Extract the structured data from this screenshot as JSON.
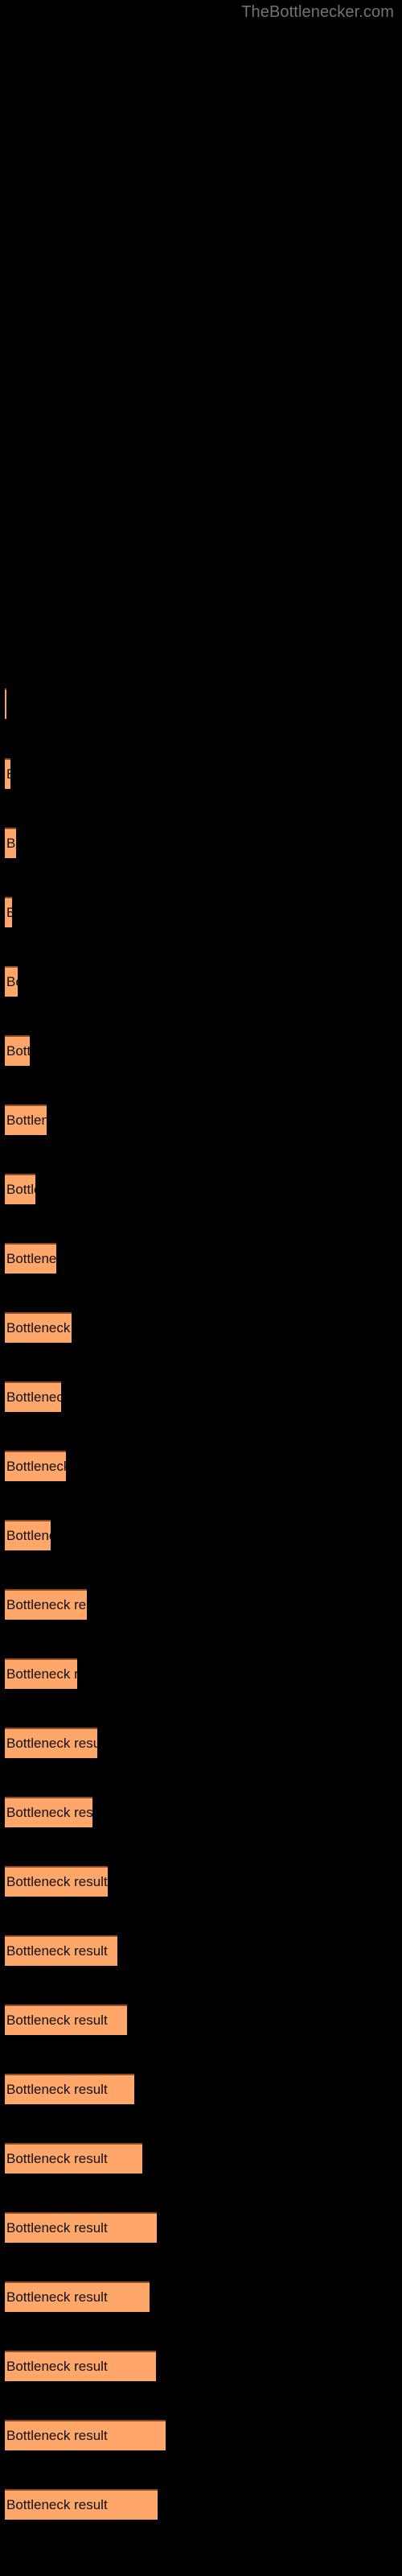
{
  "header": {
    "site_title": "TheBottlenecker.com",
    "title_color": "#737373"
  },
  "colors": {
    "background": "#000000",
    "bar_fill": "#FFA76B",
    "bar_border_top": "#8C4A1E",
    "bar_label_text": "#101010"
  },
  "chart_data": {
    "type": "bar",
    "orientation": "horizontal",
    "title": "",
    "subtitle": "",
    "xlabel": "",
    "ylabel": "",
    "grid": false,
    "legend": null,
    "axis_visible": false,
    "tick_labels": [],
    "bar_label_text": "Bottleneck result",
    "xlim": [
      0,
      200
    ],
    "categories": [
      "Bottleneck result",
      "Bottleneck result",
      "Bottleneck result",
      "Bottleneck result",
      "Bottleneck result",
      "Bottleneck result",
      "Bottleneck result",
      "Bottleneck result",
      "Bottleneck result",
      "Bottleneck result",
      "Bottleneck result",
      "Bottleneck result",
      "Bottleneck result",
      "Bottleneck result",
      "Bottleneck result",
      "Bottleneck result",
      "Bottleneck result",
      "Bottleneck result",
      "Bottleneck result",
      "Bottleneck result",
      "Bottleneck result",
      "Bottleneck result",
      "Bottleneck result",
      "Bottleneck result",
      "Bottleneck result",
      "Bottleneck result",
      "Bottleneck result"
    ],
    "values": [
      2,
      7,
      14,
      9,
      16,
      31,
      52,
      38,
      64,
      83,
      70,
      76,
      57,
      102,
      90,
      115,
      109,
      128,
      140,
      152,
      161,
      171,
      189,
      180,
      188,
      200,
      190
    ],
    "bars": [
      {
        "index": 1,
        "value": 2,
        "y": 855,
        "label": "Bottleneck result"
      },
      {
        "index": 2,
        "value": 7,
        "y": 942,
        "label": "Bottleneck result"
      },
      {
        "index": 3,
        "value": 14,
        "y": 1028,
        "label": "Bottleneck result"
      },
      {
        "index": 4,
        "value": 9,
        "y": 1114,
        "label": "Bottleneck result"
      },
      {
        "index": 5,
        "value": 16,
        "y": 1200,
        "label": "Bottleneck result"
      },
      {
        "index": 6,
        "value": 31,
        "y": 1286,
        "label": "Bottleneck result"
      },
      {
        "index": 7,
        "value": 52,
        "y": 1372,
        "label": "Bottleneck result"
      },
      {
        "index": 8,
        "value": 38,
        "y": 1458,
        "label": "Bottleneck result"
      },
      {
        "index": 9,
        "value": 64,
        "y": 1544,
        "label": "Bottleneck result"
      },
      {
        "index": 10,
        "value": 83,
        "y": 1630,
        "label": "Bottleneck result"
      },
      {
        "index": 11,
        "value": 70,
        "y": 1716,
        "label": "Bottleneck result"
      },
      {
        "index": 12,
        "value": 76,
        "y": 1802,
        "label": "Bottleneck result"
      },
      {
        "index": 13,
        "value": 57,
        "y": 1888,
        "label": "Bottleneck result"
      },
      {
        "index": 14,
        "value": 102,
        "y": 1974,
        "label": "Bottleneck result"
      },
      {
        "index": 15,
        "value": 90,
        "y": 2060,
        "label": "Bottleneck result"
      },
      {
        "index": 16,
        "value": 115,
        "y": 2146,
        "label": "Bottleneck result"
      },
      {
        "index": 17,
        "value": 109,
        "y": 2232,
        "label": "Bottleneck result"
      },
      {
        "index": 18,
        "value": 128,
        "y": 2318,
        "label": "Bottleneck result"
      },
      {
        "index": 19,
        "value": 140,
        "y": 2404,
        "label": "Bottleneck result"
      },
      {
        "index": 20,
        "value": 152,
        "y": 2490,
        "label": "Bottleneck result"
      },
      {
        "index": 21,
        "value": 161,
        "y": 2576,
        "label": "Bottleneck result"
      },
      {
        "index": 22,
        "value": 171,
        "y": 2662,
        "label": "Bottleneck result"
      },
      {
        "index": 23,
        "value": 189,
        "y": 2748,
        "label": "Bottleneck result"
      },
      {
        "index": 24,
        "value": 180,
        "y": 2834,
        "label": "Bottleneck result"
      },
      {
        "index": 25,
        "value": 188,
        "y": 2920,
        "label": "Bottleneck result"
      },
      {
        "index": 26,
        "value": 200,
        "y": 3006,
        "label": "Bottleneck result"
      },
      {
        "index": 27,
        "value": 190,
        "y": 3092,
        "label": "Bottleneck result"
      }
    ]
  }
}
